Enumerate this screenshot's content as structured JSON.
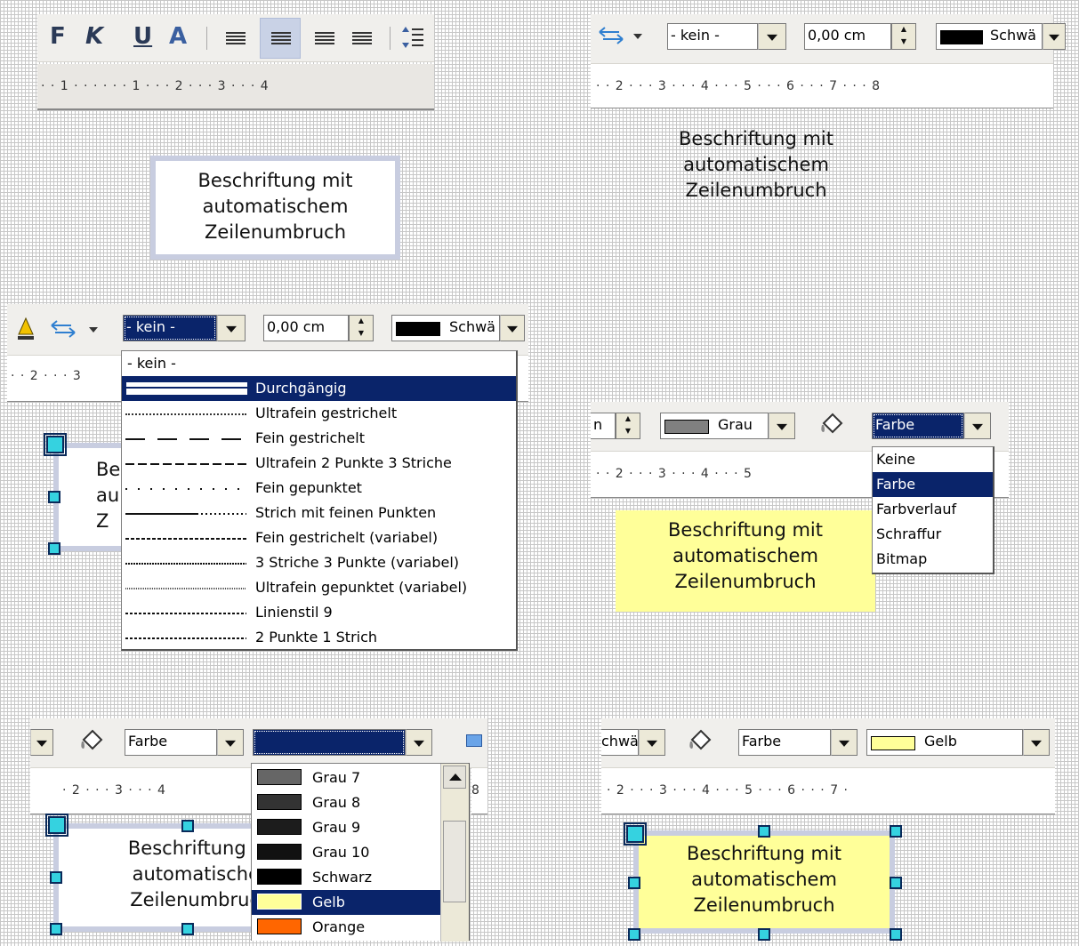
{
  "text_toolbar": {
    "bold_label": "F",
    "italic_label": "K",
    "underline_label": "U",
    "font_color_label": "A",
    "ruler": "· · 1 · · · · · · 1 · · · 2 · · · 3 · · · 4"
  },
  "caption_text": [
    "Beschriftung mit",
    "automatischem",
    "Zeilenumbruch"
  ],
  "panel_top_right": {
    "line_style_value": "- kein -",
    "line_width_value": "0,00 cm",
    "line_color_value": "Schwä",
    "ruler": "· · 2 · · · 3 · · · 4 · · · 5 · · · 6 · · · 7 · · · 8"
  },
  "panel_mid_left": {
    "line_style_value": "- kein -",
    "line_width_value": "0,00 cm",
    "line_color_value": "Schwä",
    "ruler": "· · 2 · · · 3",
    "caption_fragment": [
      "Be",
      "au",
      "Z"
    ],
    "line_style_options": [
      "- kein -",
      "Durchgängig",
      "Ultrafein gestrichelt",
      "Fein gestrichelt",
      "Ultrafein 2 Punkte 3 Striche",
      "Fein gepunktet",
      "Strich mit feinen Punkten",
      "Fein gestrichelt (variabel)",
      "3 Striche 3 Punkte (variabel)",
      "Ultrafein gepunktet (variabel)",
      "Linienstil 9",
      "2 Punkte 1 Strich"
    ],
    "selected_option": "Durchgängig"
  },
  "panel_mid_right": {
    "width_fragment": "n",
    "line_color_value": "Grau",
    "area_style_value": "Farbe",
    "ruler": "· · 2 · · · 3 · · · 4 · · · 5",
    "area_style_options": [
      "Keine",
      "Farbe",
      "Farbverlauf",
      "Schraffur",
      "Bitmap"
    ],
    "selected_option": "Farbe",
    "fill_color": "#ffff99"
  },
  "panel_bottom_left": {
    "area_style_value": "Farbe",
    "ruler": "· 2 · · · 3 · · · 4",
    "ruler_end": "8",
    "caption_fragment": [
      "Beschriftung r",
      "automatische",
      "Zeilenumbruc"
    ],
    "color_options": [
      {
        "name": "Grau 7",
        "color": "#666666"
      },
      {
        "name": "Grau 8",
        "color": "#333333"
      },
      {
        "name": "Grau 9",
        "color": "#1c1c1c"
      },
      {
        "name": "Grau 10",
        "color": "#111111"
      },
      {
        "name": "Schwarz",
        "color": "#000000"
      },
      {
        "name": "Gelb",
        "color": "#ffff99"
      },
      {
        "name": "Orange",
        "color": "#ff6600"
      }
    ],
    "selected_option": "Gelb"
  },
  "panel_bottom_right": {
    "line_color_fragment": "chwä",
    "area_style_value": "Farbe",
    "fill_color_value": "Gelb",
    "fill_color": "#ffff99",
    "ruler": "· 2 · · · 3 · · · 4 · · · 5 · · · 6 · · · 7 ·"
  },
  "colors": {
    "highlight": "#0a246a",
    "frame_border": "#c8cde0",
    "handle": "#35d2e0",
    "toolbar": "#f0efec"
  }
}
